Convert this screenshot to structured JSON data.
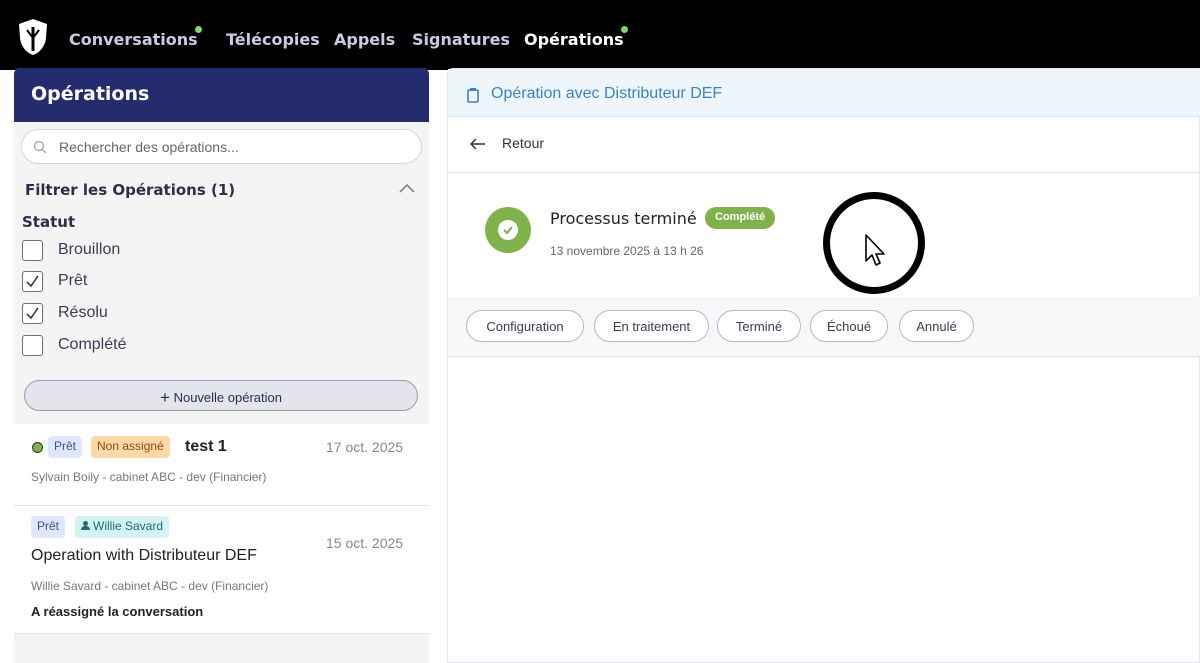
{
  "nav": {
    "items": [
      {
        "label": "Conversations",
        "dot": true
      },
      {
        "label": "Télécopies"
      },
      {
        "label": "Appels"
      },
      {
        "label": "Signatures"
      },
      {
        "label": "Opérations",
        "dot": true,
        "active": true
      }
    ],
    "logo_icon": "shield-logo",
    "dot_color": "#8bd36b"
  },
  "sidebar": {
    "title": "Opérations",
    "search_placeholder": "Rechercher des opérations...",
    "filter_title": "Filtrer les Opérations (1)",
    "status_label": "Statut",
    "statuses": [
      {
        "label": "Brouillon",
        "checked": false
      },
      {
        "label": "Prêt",
        "checked": true
      },
      {
        "label": "Résolu",
        "checked": true
      },
      {
        "label": "Complété",
        "checked": false
      }
    ],
    "new_button": "Nouvelle opération",
    "operations": [
      {
        "status_badge": "Prêt",
        "assign_badge": "Non assigné",
        "title": "test 1",
        "subtitle": "Sylvain Boily - cabinet ABC - dev (Financier)",
        "date": "17 oct. 2025"
      },
      {
        "status_badge": "Prêt",
        "assign_badge": "Willie Savard",
        "title": "Operation with Distributeur DEF",
        "subtitle": "Willie Savard - cabinet ABC - dev (Financier)",
        "date": "15 oct. 2025",
        "note": "A réassigné la conversation"
      }
    ]
  },
  "detail": {
    "header_title": "Opération avec Distributeur DEF",
    "back_label": "Retour",
    "process_title": "Processus terminé",
    "process_badge": "Complété",
    "process_date": "13 novembre 2025 à 13 h 26",
    "steps": [
      "Configuration",
      "En traitement",
      "Terminé",
      "Échoué",
      "Annulé"
    ]
  },
  "colors": {
    "accent_dark": "#242c6e",
    "success": "#7fb24a",
    "link": "#3d82c6"
  }
}
